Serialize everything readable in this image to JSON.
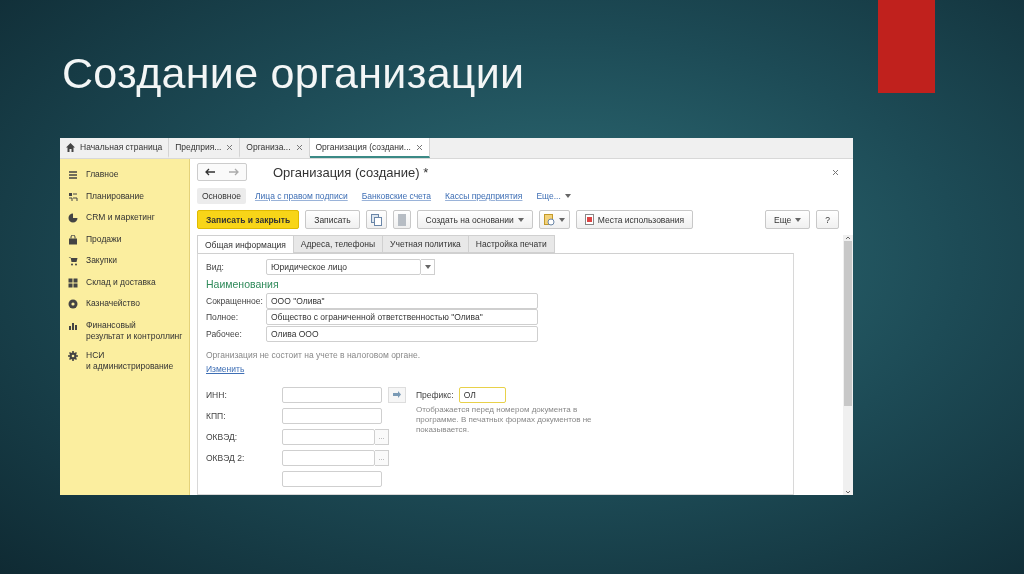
{
  "slide": {
    "title": "Создание организации"
  },
  "app": {
    "home_tab": {
      "label": "Начальная страница",
      "selected": false
    },
    "tabs": [
      {
        "label": "Предприя...",
        "selected": false
      },
      {
        "label": "Организа...",
        "selected": false
      },
      {
        "label": "Организация (создани...",
        "selected": true
      }
    ],
    "sidebar": {
      "items": [
        {
          "kind": "menu",
          "label": "Главное"
        },
        {
          "kind": "plan",
          "label": "Планирование"
        },
        {
          "kind": "pie",
          "label": "CRM и маркетинг"
        },
        {
          "kind": "bag",
          "label": "Продажи"
        },
        {
          "kind": "cart",
          "label": "Закупки"
        },
        {
          "kind": "boxes",
          "label": "Склад и доставка"
        },
        {
          "kind": "coin",
          "label": "Казначейство"
        },
        {
          "kind": "chart",
          "label": "Финансовый\nрезультат и контроллинг"
        },
        {
          "kind": "gear",
          "label": "НСИ\nи администрирование"
        }
      ]
    },
    "form": {
      "title": "Организация (создание) *",
      "nav": [
        {
          "kind": "back",
          "disabled": false
        },
        {
          "kind": "forward",
          "disabled": true
        }
      ],
      "sections": [
        {
          "label": "Основное",
          "selected": true
        },
        {
          "label": "Лица с правом подписи",
          "selected": false
        },
        {
          "label": "Банковские счета",
          "selected": false
        },
        {
          "label": "Кассы предприятия",
          "selected": false
        }
      ],
      "sections_more": "Еще...",
      "toolbar": [
        {
          "kind": "primary",
          "label": "Записать и закрыть"
        },
        {
          "kind": "button",
          "label": "Записать"
        },
        {
          "kind": "copy"
        },
        {
          "kind": "card"
        },
        {
          "kind": "dropdown",
          "label": "Создать на основании"
        },
        {
          "kind": "report"
        },
        {
          "kind": "doc",
          "label": "Места использования"
        }
      ],
      "toolbar_right": [
        {
          "kind": "dropdown",
          "label": "Еще"
        },
        {
          "kind": "button",
          "label": "?"
        }
      ],
      "tabs": [
        {
          "label": "Общая информация",
          "selected": true
        },
        {
          "label": "Адреса, телефоны",
          "selected": false
        },
        {
          "label": "Учетная политика",
          "selected": false
        },
        {
          "label": "Настройка печати",
          "selected": false
        }
      ],
      "type_field": {
        "label": "Вид:",
        "value": "Юридическое лицо"
      },
      "names_heading": "Наименования",
      "names": [
        {
          "label": "Сокращенное:",
          "value": "ООО \"Олива\""
        },
        {
          "label": "Полное:",
          "value": "Общество с ограниченной ответственностью \"Олива\""
        },
        {
          "label": "Рабочее:",
          "value": "Олива ООО"
        }
      ],
      "tax_note": "Организация не состоит на учете в налоговом органе.",
      "tax_link": "Изменить",
      "codes": [
        {
          "kind": "fetch",
          "label": "ИНН:"
        },
        {
          "kind": "plain",
          "label": "КПП:"
        },
        {
          "kind": "choice",
          "label": "ОКВЭД:",
          "button": "..."
        },
        {
          "kind": "choice",
          "label": "ОКВЭД 2:",
          "button": "..."
        },
        {
          "kind": "cut"
        }
      ],
      "prefix": {
        "label": "Префикс:",
        "value": "ОЛ",
        "hint": "Отображается перед номером документа в программе. В печатных формах документов не показывается."
      }
    }
  }
}
